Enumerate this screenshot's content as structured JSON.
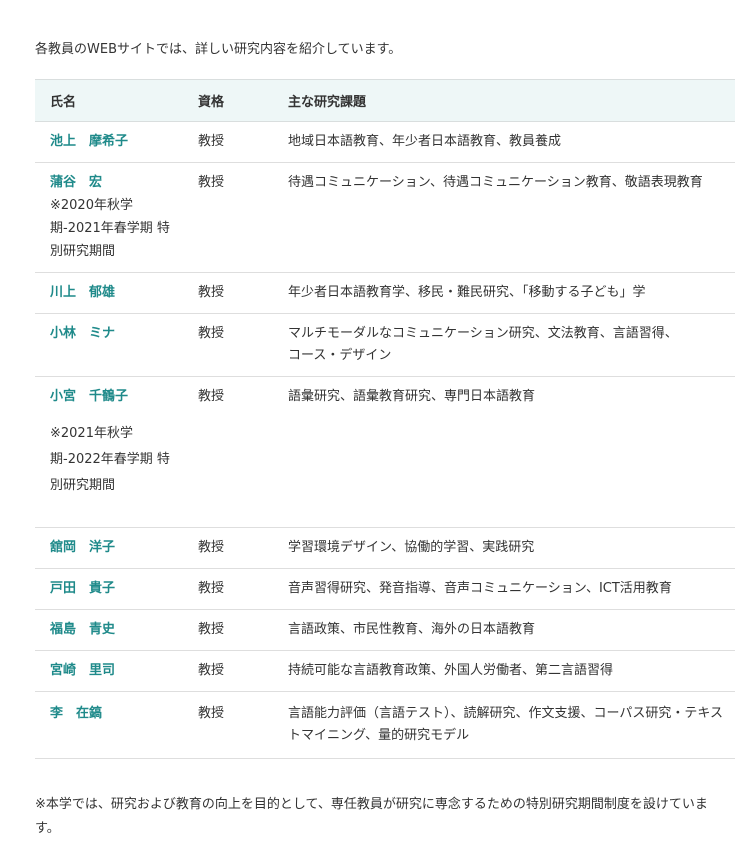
{
  "intro": "各教員のWEBサイトでは、詳しい研究内容を紹介しています。",
  "table": {
    "headers": [
      "氏名",
      "資格",
      "主な研究課題"
    ],
    "rows": [
      {
        "name": "池上　摩希子",
        "note": "",
        "rank": "教授",
        "topics": [
          "地域日本語教育、年少者日本語教育、教員養成"
        ]
      },
      {
        "name": "蒲谷　宏",
        "note": "※2020年秋学期-2021年春学期 特別研究期間",
        "rank": "教授",
        "topics": [
          "待遇コミュニケーション、待遇コミュニケーション教育、敬語表現教育"
        ]
      },
      {
        "name": "川上　郁雄",
        "note": "",
        "rank": "教授",
        "topics": [
          "年少者日本語教育学、移民・難民研究、「移動する子ども」学"
        ]
      },
      {
        "name": "小林　ミナ",
        "note": "",
        "rank": "教授",
        "topics": [
          "マルチモーダルなコミュニケーション研究、文法教育、言語習得、",
          "コース・デザイン"
        ]
      },
      {
        "name": "小宮　千鶴子",
        "note": "※2021年秋学期-2022年春学期 特別研究期間",
        "rank": "教授",
        "topics": [
          "語彙研究、語彙教育研究、専門日本語教育"
        ]
      },
      {
        "name": "舘岡　洋子",
        "note": "",
        "rank": "教授",
        "topics": [
          "学習環境デザイン、協働的学習、実践研究"
        ]
      },
      {
        "name": "戸田　貴子",
        "note": "",
        "rank": "教授",
        "topics": [
          "音声習得研究、発音指導、音声コミュニケーション、ICT活用教育"
        ]
      },
      {
        "name": "福島　青史",
        "note": "",
        "rank": "教授",
        "topics": [
          "言語政策、市民性教育、海外の日本語教育"
        ]
      },
      {
        "name": "宮崎　里司",
        "note": "",
        "rank": "教授",
        "topics": [
          "持続可能な言語教育政策、外国人労働者、第二言語習得"
        ]
      },
      {
        "name": "李　在鎬",
        "note": "",
        "rank": "教授",
        "topics": [
          "言語能力評価（言語テスト）、読解研究、作文支援、コーパス研究・テキス",
          "トマイニング、量的研究モデル"
        ]
      }
    ]
  },
  "footer": "※本学では、研究および教育の向上を目的として、専任教員が研究に専念するための特別研究期間制度を設けています。",
  "colors": {
    "name_link": "#1f8a8a",
    "header_bg": "#eef7f7",
    "text": "#333333",
    "border": "#dedede"
  }
}
